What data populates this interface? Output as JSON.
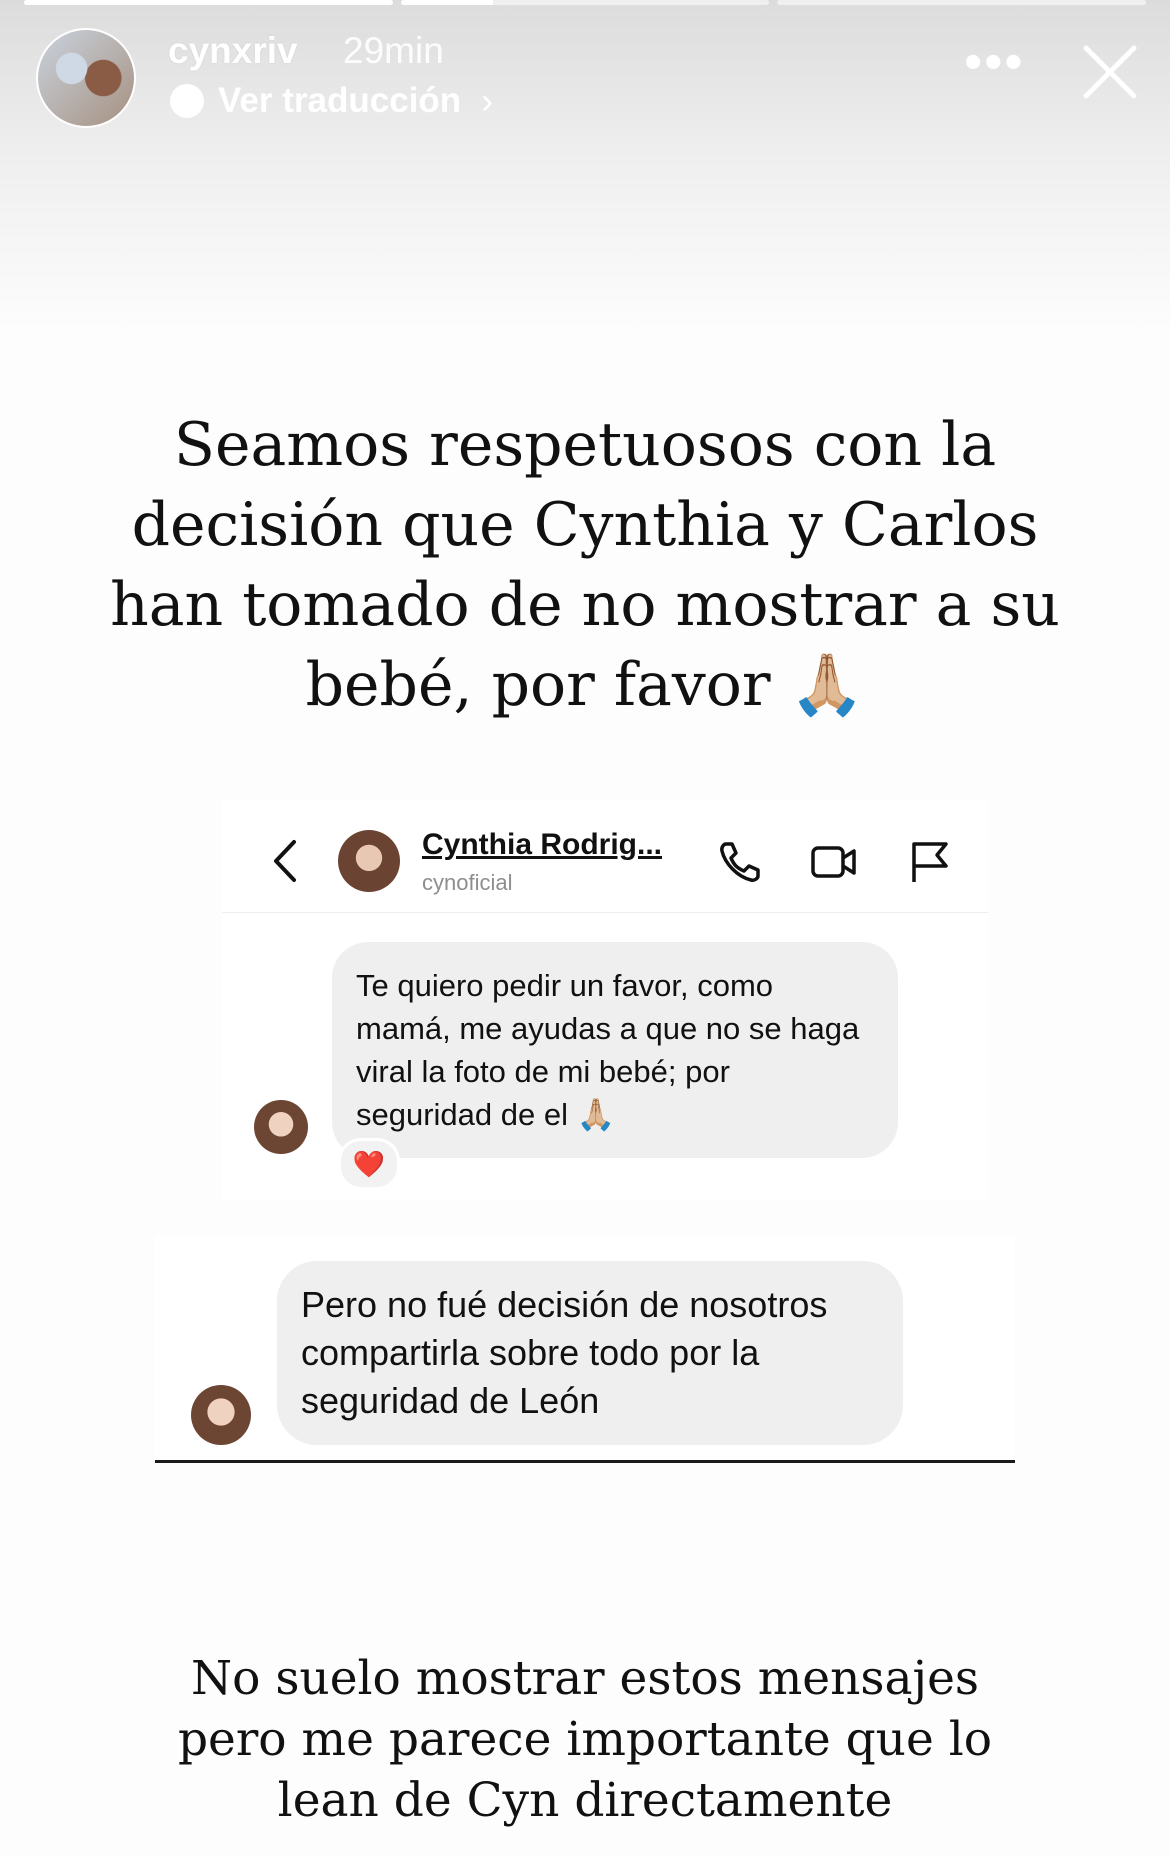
{
  "story": {
    "username": "cynxriv",
    "time": "29min",
    "translate_label": "Ver traducción",
    "progress": [
      1.0,
      0.25,
      0.0
    ]
  },
  "headline": "Seamos respetuosos con la decisión que Cynthia y Carlos han tomado de no mostrar a su bebé, por favor 🙏🏼",
  "dm": {
    "contact_name": "Cynthia Rodrig...",
    "contact_handle": "cynoficial",
    "message1": "Te quiero pedir un favor, como mamá, me ayudas a que no se haga viral la foto de mi bebé; por seguridad de el 🙏🏼",
    "reaction": "❤️",
    "message2": "Pero no fué decisión de nosotros compartirla sobre todo por la seguridad de León"
  },
  "footer_text": "No suelo mostrar estos mensajes pero me parece importante que lo lean de Cyn directamente",
  "colors": {
    "bubble": "#efefef",
    "text": "#111111",
    "overlay_text": "#ffffff"
  }
}
